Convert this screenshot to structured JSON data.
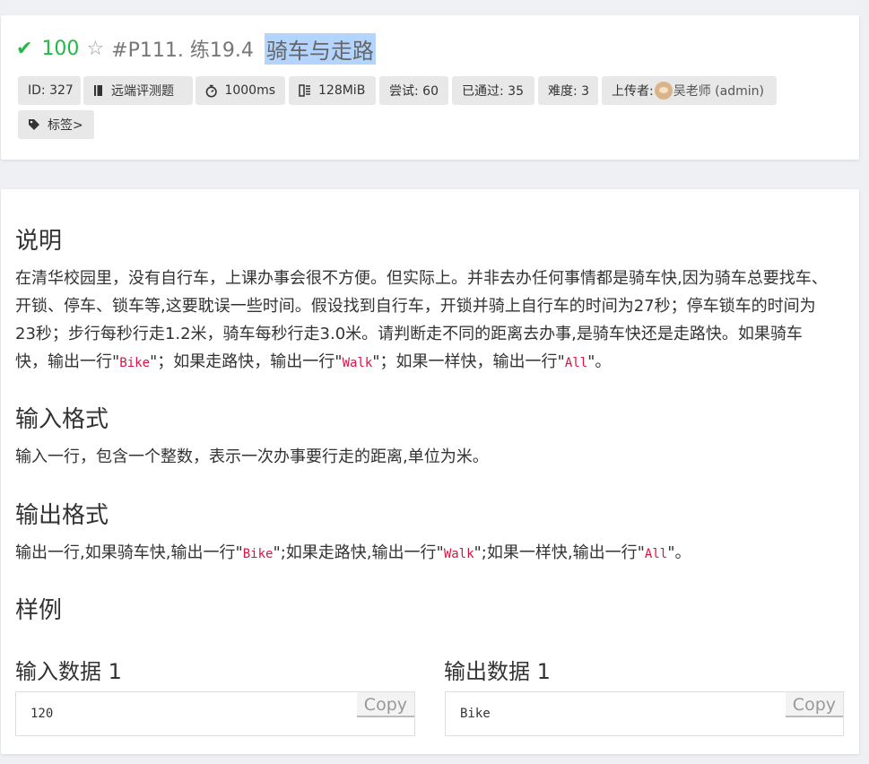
{
  "header": {
    "score": "100",
    "problem_id": "#P111. 练19.4",
    "problem_title": "骑车与走路"
  },
  "tags": {
    "id": "ID: 327",
    "judge": "远端评测题",
    "time": "1000ms",
    "memory": "128MiB",
    "attempts": "尝试: 60",
    "passed": "已通过: 35",
    "difficulty": "难度: 3",
    "uploader_label": "上传者:",
    "uploader_name": "吴老师 (admin)",
    "labels": "标签>"
  },
  "content": {
    "desc_title": "说明",
    "desc_part1": "在清华校园里，没有自行车，上课办事会很不方便。但实际上。并非去办任何事情都是骑车快,因为骑车总要找车、开锁、停车、锁车等,这要耽误一些时间。假设找到自行车，开锁并骑上自行车的时间为27秒；停车锁车的时间为23秒；步行每秒行走1.2米，骑车每秒行走3.0米。请判断走不同的距离去办事,是骑车快还是走路快。如果骑车快，输出一行\"",
    "desc_code1": "Bike",
    "desc_part2": "\"；如果走路快，输出一行\"",
    "desc_code2": "Walk",
    "desc_part3": "\"；如果一样快，输出一行\"",
    "desc_code3": "All",
    "desc_part4": "\"。",
    "input_title": "输入格式",
    "input_text": "输入一行，包含一个整数，表示一次办事要行走的距离,单位为米。",
    "output_title": "输出格式",
    "output_part1": "输出一行,如果骑车快,输出一行\"",
    "output_code1": "Bike",
    "output_part2": "\";如果走路快,输出一行\"",
    "output_code2": "Walk",
    "output_part3": "\";如果一样快,输出一行\"",
    "output_code3": "All",
    "output_part4": "\"。",
    "sample_title": "样例",
    "sample_input_title": "输入数据 1",
    "sample_input_value": "120",
    "sample_output_title": "输出数据 1",
    "sample_output_value": "Bike",
    "copy_label": "Copy"
  }
}
